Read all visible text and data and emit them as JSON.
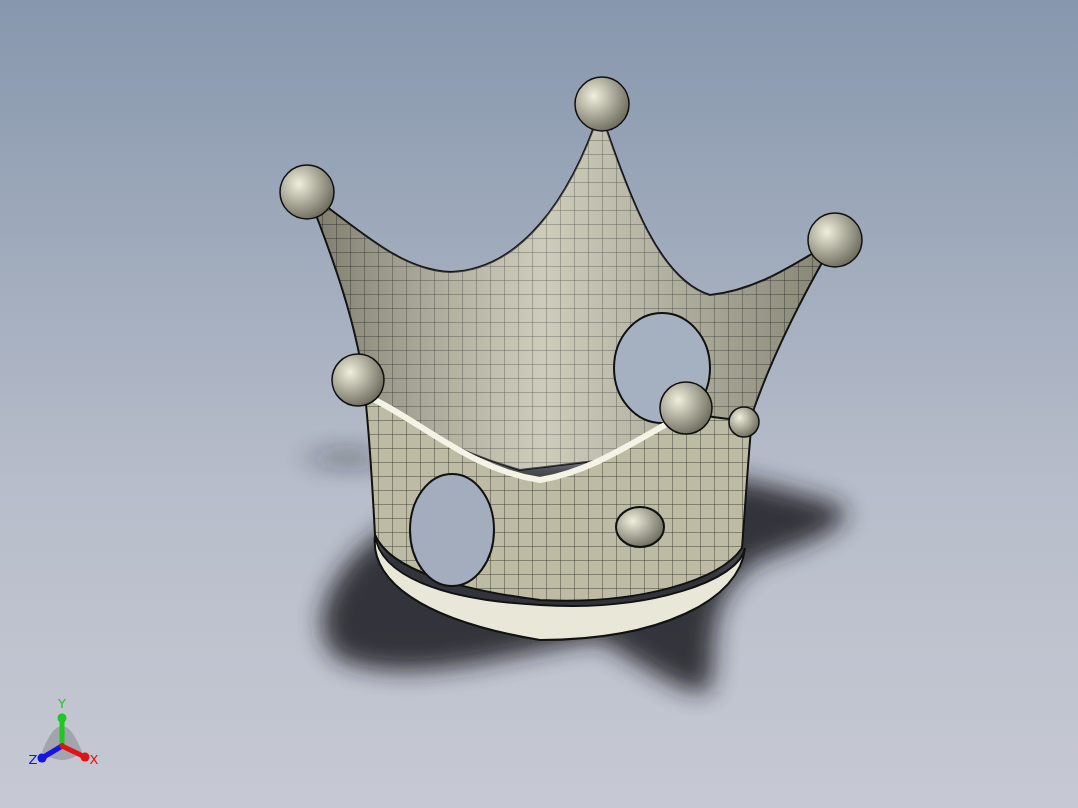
{
  "viewport": {
    "triad": {
      "axes": [
        {
          "kind": "y",
          "label": "Y",
          "color": "#1ec81e"
        },
        {
          "kind": "z",
          "label": "Z",
          "color": "#1414e6"
        },
        {
          "kind": "x",
          "label": "X",
          "color": "#e01414"
        }
      ]
    }
  }
}
